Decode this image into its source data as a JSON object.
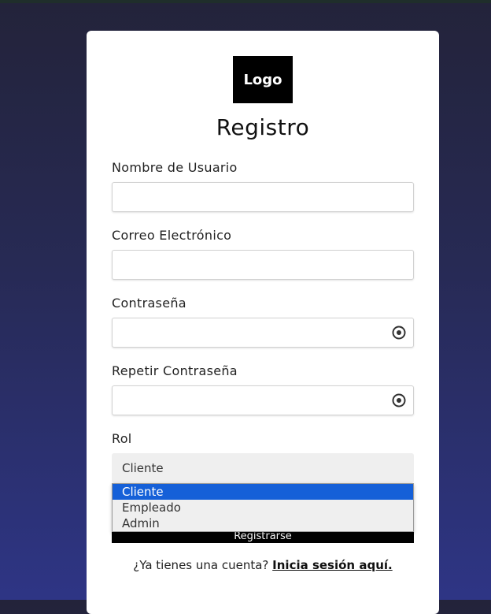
{
  "logo": "Logo",
  "form": {
    "title": "Registro",
    "username_label": "Nombre de Usuario",
    "email_label": "Correo Electrónico",
    "password_label": "Contraseña",
    "repeat_password_label": "Repetir Contraseña",
    "role_label": "Rol",
    "role_selected": "Cliente",
    "role_options": [
      "Cliente",
      "Empleado",
      "Admin"
    ],
    "submit_label": "Registrarse"
  },
  "footer": {
    "prompt": "¿Ya tienes una cuenta?",
    "link": "Inicia sesión aquí."
  },
  "colors": {
    "accent": "#1560d8",
    "button": "#000000",
    "background_top": "#23233a",
    "background_bottom": "#2e3585"
  },
  "icons": {
    "password_toggle": "eye-icon",
    "repeat_password_toggle": "eye-icon"
  }
}
